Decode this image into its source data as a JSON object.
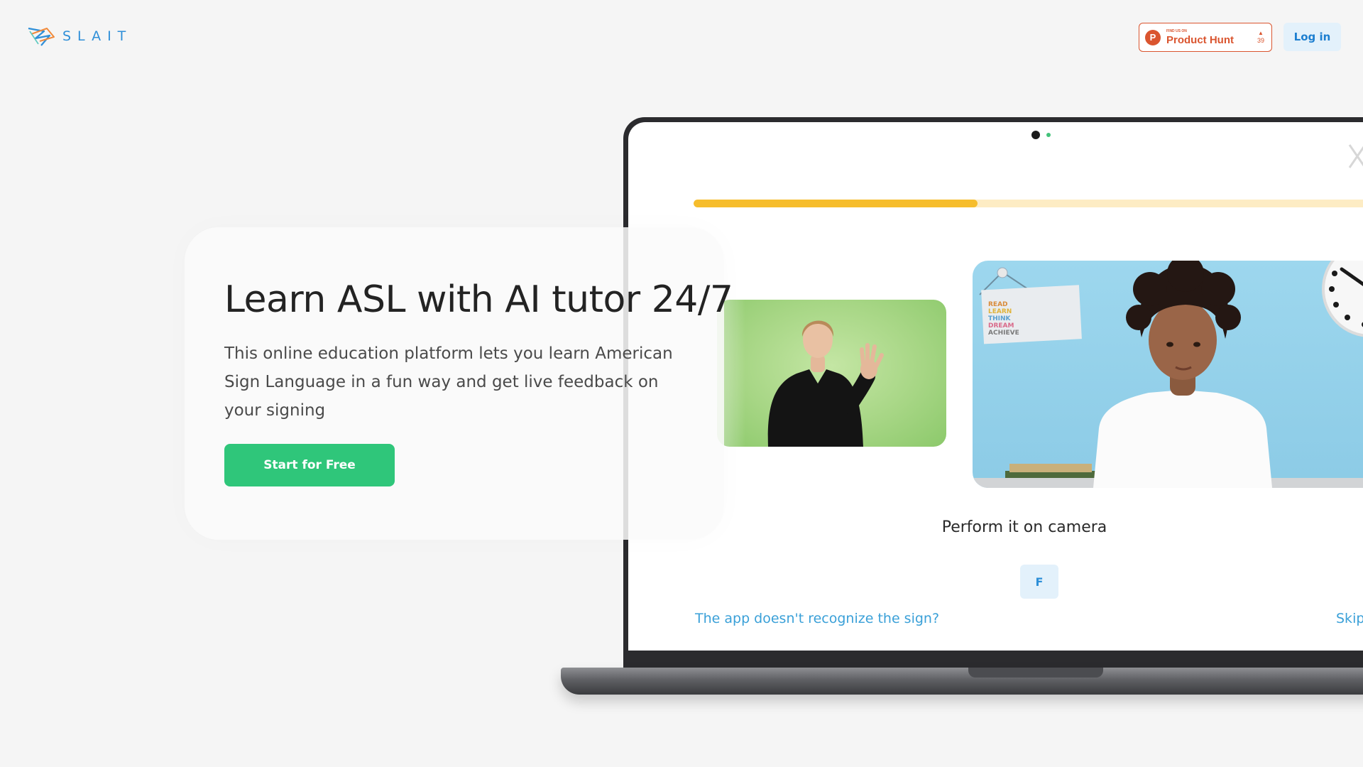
{
  "header": {
    "logo_text": "SLAIT",
    "product_hunt": {
      "small_text": "FIND US ON",
      "name": "Product Hunt",
      "votes": "39"
    },
    "login_label": "Log in"
  },
  "hero": {
    "title": "Learn ASL with AI tutor 24/7",
    "description": "This online education platform lets you learn American Sign Language in a fun way and get live feedback on your signing",
    "cta_label": "Start for Free"
  },
  "lesson": {
    "progress_fraction": 0.4,
    "instruction": "Perform it on camera",
    "current_letter": "F",
    "help_link": "The app doesn't recognize the sign?",
    "skip_link": "Skip",
    "poster_lines": [
      "READ",
      "LEARN",
      "THINK",
      "DREAM",
      "ACHIEVE"
    ]
  },
  "colors": {
    "accent_green": "#2fc67a",
    "accent_blue": "#2d8fd8",
    "progress_yellow": "#f6bd2c",
    "product_hunt_orange": "#da552f"
  },
  "icons": [
    "slait-logo-icon",
    "product-hunt-icon",
    "upvote-arrow-icon",
    "close-icon"
  ]
}
